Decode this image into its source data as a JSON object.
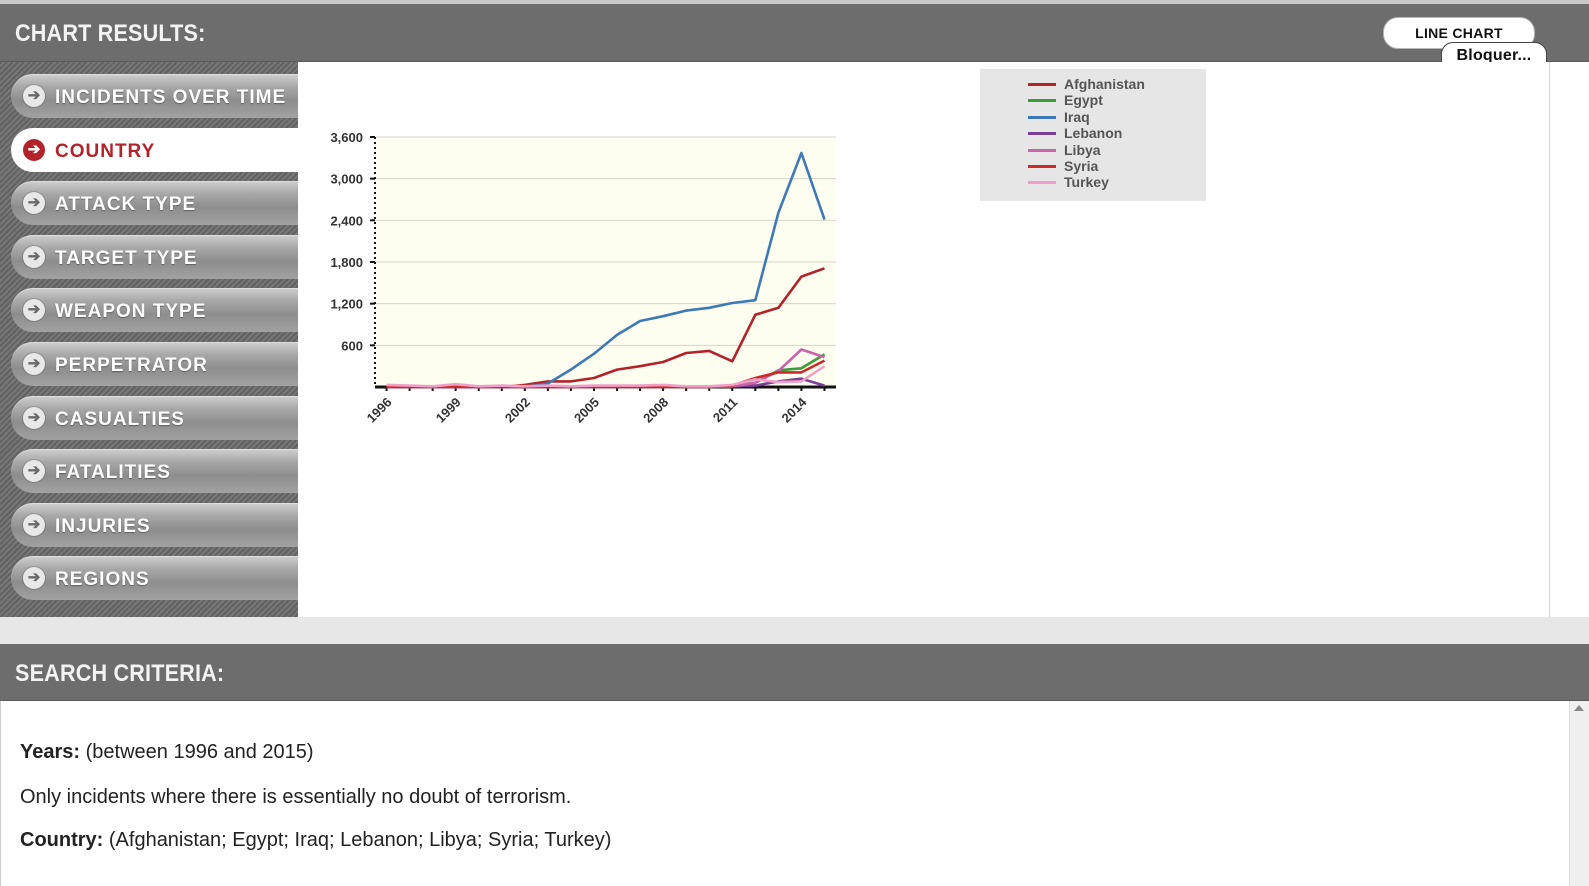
{
  "chart_header": {
    "title": "CHART RESULTS:",
    "chart_type_button": "LINE CHART",
    "blocker_label": "Bloquer..."
  },
  "sidebar": {
    "items": [
      {
        "label": "INCIDENTS OVER TIME",
        "active": false
      },
      {
        "label": "COUNTRY",
        "active": true
      },
      {
        "label": "ATTACK TYPE",
        "active": false
      },
      {
        "label": "TARGET TYPE",
        "active": false
      },
      {
        "label": "WEAPON TYPE",
        "active": false
      },
      {
        "label": "PERPETRATOR",
        "active": false
      },
      {
        "label": "CASUALTIES",
        "active": false
      },
      {
        "label": "FATALITIES",
        "active": false
      },
      {
        "label": "INJURIES",
        "active": false
      },
      {
        "label": "REGIONS",
        "active": false
      }
    ],
    "arrow_icon": "arrow-right-circle-icon"
  },
  "legend": {
    "items": [
      {
        "label": "Afghanistan",
        "color": "#b3232a"
      },
      {
        "label": "Egypt",
        "color": "#3f9a3a"
      },
      {
        "label": "Iraq",
        "color": "#3d79b8"
      },
      {
        "label": "Lebanon",
        "color": "#7a3f95"
      },
      {
        "label": "Libya",
        "color": "#c864a8"
      },
      {
        "label": "Syria",
        "color": "#cc2a2a"
      },
      {
        "label": "Turkey",
        "color": "#f0a0c8"
      }
    ]
  },
  "chart_data": {
    "type": "line",
    "title": "",
    "xlabel": "",
    "ylabel": "",
    "x": [
      1996,
      1997,
      1998,
      1999,
      2000,
      2001,
      2002,
      2003,
      2004,
      2005,
      2006,
      2007,
      2008,
      2009,
      2010,
      2011,
      2012,
      2013,
      2014,
      2015
    ],
    "xticks": [
      "1996",
      "1999",
      "2002",
      "2005",
      "2008",
      "2011",
      "2014"
    ],
    "yticks": [
      "600",
      "1,200",
      "1,800",
      "2,400",
      "3,000",
      "3,600"
    ],
    "ylim": [
      0,
      3600
    ],
    "xlim": [
      1995.5,
      2015.5
    ],
    "grid": true,
    "legend_position": "top-right",
    "series": [
      {
        "name": "Afghanistan",
        "color": "#b3232a",
        "values": [
          0,
          0,
          0,
          0,
          0,
          0,
          30,
          80,
          80,
          130,
          250,
          300,
          360,
          490,
          520,
          370,
          1040,
          1140,
          1590,
          1710
        ]
      },
      {
        "name": "Egypt",
        "color": "#3f9a3a",
        "values": [
          10,
          5,
          5,
          5,
          5,
          0,
          0,
          0,
          0,
          0,
          0,
          0,
          0,
          0,
          0,
          20,
          60,
          240,
          270,
          470
        ]
      },
      {
        "name": "Iraq",
        "color": "#3d79b8",
        "values": [
          0,
          0,
          0,
          0,
          0,
          0,
          0,
          50,
          250,
          480,
          750,
          950,
          1020,
          1100,
          1140,
          1210,
          1250,
          2510,
          3370,
          2410
        ]
      },
      {
        "name": "Lebanon",
        "color": "#7a3f95",
        "values": [
          10,
          5,
          5,
          10,
          5,
          0,
          0,
          0,
          0,
          0,
          5,
          5,
          10,
          5,
          5,
          10,
          20,
          80,
          120,
          20
        ]
      },
      {
        "name": "Libya",
        "color": "#c864a8",
        "values": [
          0,
          0,
          0,
          0,
          0,
          0,
          0,
          0,
          0,
          0,
          0,
          0,
          0,
          0,
          0,
          10,
          60,
          230,
          540,
          430
        ]
      },
      {
        "name": "Syria",
        "color": "#cc2a2a",
        "values": [
          0,
          0,
          0,
          0,
          0,
          0,
          0,
          0,
          0,
          0,
          0,
          0,
          0,
          0,
          0,
          20,
          130,
          210,
          210,
          380
        ]
      },
      {
        "name": "Turkey",
        "color": "#f0a0c8",
        "values": [
          30,
          20,
          10,
          40,
          10,
          20,
          10,
          20,
          10,
          20,
          20,
          20,
          30,
          10,
          10,
          30,
          110,
          70,
          80,
          300
        ]
      }
    ]
  },
  "search_header": {
    "title": "SEARCH CRITERIA:"
  },
  "criteria": {
    "years_label": "Years:",
    "years_value": " (between 1996 and 2015)",
    "doubt_text": "Only incidents where there is essentially no doubt of terrorism.",
    "country_label": "Country:",
    "country_value": " (Afghanistan; Egypt; Iraq; Lebanon; Libya; Syria; Turkey)"
  }
}
